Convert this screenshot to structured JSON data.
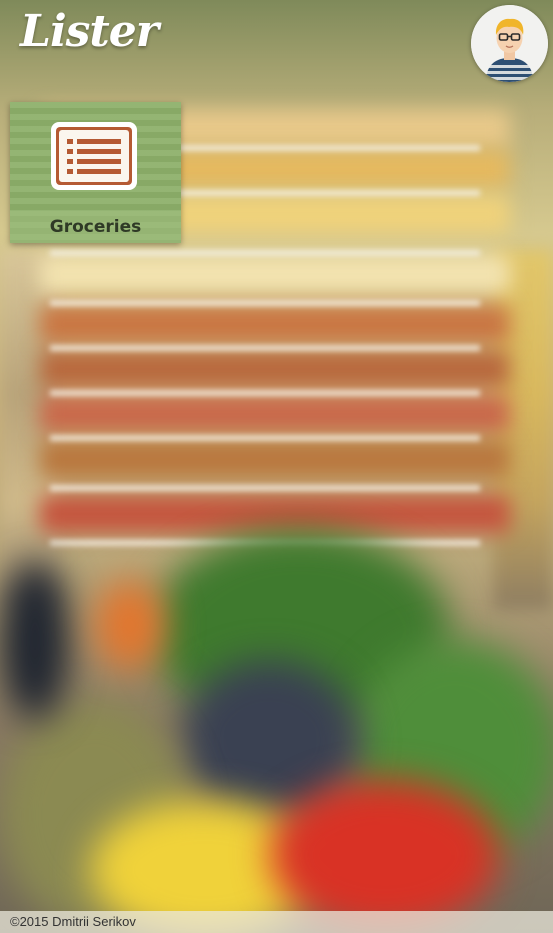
{
  "app": {
    "logo": "Lister",
    "avatar_icon": "user-avatar-icon"
  },
  "lists": [
    {
      "label": "Groceries",
      "icon": "list-icon",
      "color": "#8db06a"
    }
  ],
  "footer": {
    "copyright": "©2015 Dmitrii Serikov"
  },
  "background": {
    "description_icon": "supermarket-background-image"
  }
}
